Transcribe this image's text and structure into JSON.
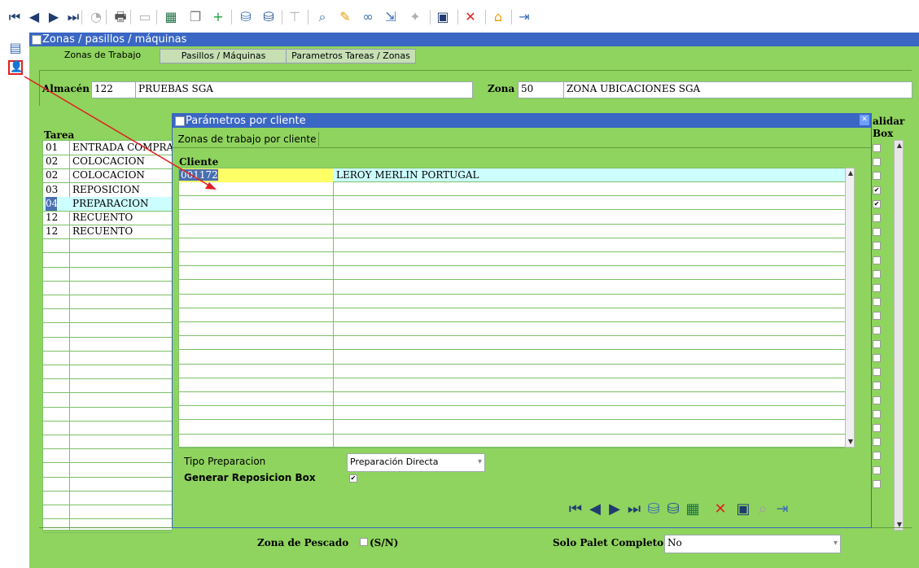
{
  "toolbar": {
    "icons": [
      {
        "name": "first-record-icon",
        "glyph": "⏮",
        "color": "#1f3b70"
      },
      {
        "name": "previous-record-icon",
        "glyph": "◀",
        "color": "#1f3b70"
      },
      {
        "name": "next-record-icon",
        "glyph": "▶",
        "color": "#1f3b70"
      },
      {
        "name": "last-record-icon",
        "glyph": "⏭",
        "color": "#1f3b70"
      },
      {
        "name": "chart-icon",
        "glyph": "◔",
        "color": "#b0b0b0"
      },
      {
        "name": "print-icon",
        "glyph": "🖶",
        "color": "#555555"
      },
      {
        "name": "display-icon",
        "glyph": "▭",
        "color": "#b0b0b0"
      },
      {
        "name": "excel-icon",
        "glyph": "▦",
        "color": "#1e7145"
      },
      {
        "name": "copy-icon",
        "glyph": "❐",
        "color": "#777777"
      },
      {
        "name": "add-icon",
        "glyph": "+",
        "color": "#1aa53a"
      },
      {
        "name": "database-icon",
        "glyph": "⛁",
        "color": "#3b6fb6"
      },
      {
        "name": "database-alt-icon",
        "glyph": "⛁",
        "color": "#1f4f96"
      },
      {
        "name": "filter-icon",
        "glyph": "⊤",
        "color": "#b0b0b0"
      },
      {
        "name": "search-icon",
        "glyph": "⌕",
        "color": "#3b6fb6"
      },
      {
        "name": "edit-pencil-icon",
        "glyph": "✎",
        "color": "#e6a000"
      },
      {
        "name": "link-icon",
        "glyph": "∞",
        "color": "#3b6fb6"
      },
      {
        "name": "export-icon",
        "glyph": "⇲",
        "color": "#3b6fb6"
      },
      {
        "name": "query-icon",
        "glyph": "✦",
        "color": "#b0b0b0"
      },
      {
        "name": "save-icon",
        "glyph": "▣",
        "color": "#1f3b70"
      },
      {
        "name": "delete-icon",
        "glyph": "✕",
        "color": "#e02020"
      },
      {
        "name": "home-icon",
        "glyph": "⌂",
        "color": "#f0a000"
      },
      {
        "name": "exit-icon",
        "glyph": "⇥",
        "color": "#3b6fb6"
      }
    ]
  },
  "side": {
    "icons": [
      {
        "name": "document-icon",
        "glyph": "▤",
        "color": "#3b6fb6"
      },
      {
        "name": "user-icon",
        "glyph": "👤",
        "color": "#3b6fb6"
      }
    ]
  },
  "main_window": {
    "title": "Zonas / pasillos / máquinas",
    "tabs": [
      "Zonas de Trabajo",
      "Pasillos / Máquinas",
      "Parametros Tareas / Zonas"
    ],
    "almacen_label": "Almacén",
    "almacen_code": "122",
    "almacen_name": "PRUEBAS SGA",
    "zona_label": "Zona",
    "zona_code": "50",
    "zona_name": "ZONA UBICACIONES  SGA",
    "tarea_header": "Tarea",
    "tasks": [
      {
        "code": "01",
        "name": "ENTRADA COMPRAS"
      },
      {
        "code": "02",
        "name": "COLOCACION"
      },
      {
        "code": "02",
        "name": "COLOCACION"
      },
      {
        "code": "03",
        "name": "REPOSICION"
      },
      {
        "code": "04",
        "name": "PREPARACION"
      },
      {
        "code": "12",
        "name": "RECUENTO"
      },
      {
        "code": "12",
        "name": "RECUENTO"
      }
    ],
    "validar_header_1": "alidar",
    "validar_header_2": "Box",
    "checkbox_checked": [
      false,
      false,
      false,
      true,
      true,
      false,
      false,
      false,
      false,
      false,
      false,
      false,
      false,
      false,
      false,
      false,
      false,
      false,
      false,
      false,
      false,
      false,
      false,
      false,
      false
    ],
    "checkmark": "✔",
    "zona_pescado_label": "Zona de Pescado",
    "zona_pescado_suffix": "(S/N)",
    "solo_palet_label": "Solo Palet Completo",
    "solo_palet_value": "No"
  },
  "dialog": {
    "title": "Parámetros por cliente",
    "close_glyph": "✕",
    "tab": "Zonas de trabajo por cliente",
    "cliente_header": "Cliente",
    "rows": [
      {
        "code": "001172",
        "name": "LEROY MERLIN PORTUGAL"
      }
    ],
    "tipo_label": "Tipo Preparacion",
    "tipo_value": "Preparación Directa",
    "generar_label": "Generar Reposicion Box",
    "generar_check": "✔",
    "dropdown_glyph": "▾",
    "buttons": [
      {
        "name": "dlg-first-icon",
        "glyph": "⏮",
        "color": "#1f3b70"
      },
      {
        "name": "dlg-previous-icon",
        "glyph": "◀",
        "color": "#1f3b70"
      },
      {
        "name": "dlg-next-icon",
        "glyph": "▶",
        "color": "#1f3b70"
      },
      {
        "name": "dlg-last-icon",
        "glyph": "⏭",
        "color": "#1f3b70"
      },
      {
        "name": "dlg-database-icon",
        "glyph": "⛁",
        "color": "#3b6fb6"
      },
      {
        "name": "dlg-database-alt-icon",
        "glyph": "⛁",
        "color": "#1f4f96"
      },
      {
        "name": "dlg-excel-icon",
        "glyph": "▦",
        "color": "#1e7145"
      },
      {
        "name": "dlg-delete-icon",
        "glyph": "✕",
        "color": "#e02020"
      },
      {
        "name": "dlg-save-icon",
        "glyph": "▣",
        "color": "#1f3b70"
      },
      {
        "name": "dlg-search-icon",
        "glyph": "⌕",
        "color": "#a0a0a0"
      },
      {
        "name": "dlg-exit-icon",
        "glyph": "⇥",
        "color": "#3b6fb6"
      }
    ]
  },
  "colors": {
    "panel_green": "#8fd45e",
    "title_blue": "#3a66c4",
    "highlight_yellow": "#ffff66",
    "row_highlight": "#ccffff",
    "annotation_red": "#e02020"
  }
}
